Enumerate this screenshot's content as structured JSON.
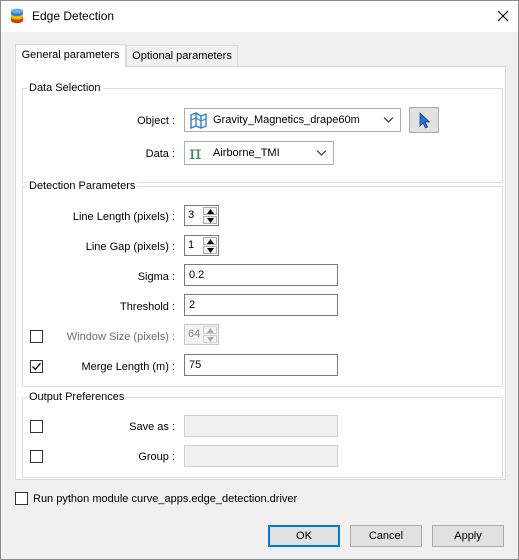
{
  "window": {
    "title": "Edge Detection",
    "close_icon": "close-icon",
    "accent": "#0078d7"
  },
  "tabs": [
    {
      "label": "General parameters",
      "active": true
    },
    {
      "label": "Optional parameters",
      "active": false
    }
  ],
  "data_selection": {
    "title": "Data Selection",
    "object_label": "Object :",
    "object_value": "Gravity_Magnetics_drape60m",
    "object_icon": "surface-mesh-icon",
    "pick_icon": "cursor-arrow-icon",
    "data_label": "Data :",
    "data_value": "Airborne_TMI",
    "data_icon": "pi-icon"
  },
  "detection": {
    "title": "Detection Parameters",
    "line_length_label": "Line Length (pixels) :",
    "line_length_value": "3",
    "line_gap_label": "Line Gap (pixels) :",
    "line_gap_value": "1",
    "sigma_label": "Sigma :",
    "sigma_value": "0.2",
    "threshold_label": "Threshold :",
    "threshold_value": "2",
    "window_size_label": "Window Size (pixels) :",
    "window_size_value": "64",
    "window_size_checked": false,
    "merge_length_label": "Merge Length (m) :",
    "merge_length_value": "75",
    "merge_length_checked": true
  },
  "output": {
    "title": "Output Preferences",
    "save_as_label": "Save as :",
    "save_as_value": "",
    "group_label": "Group :",
    "group_value": ""
  },
  "run_python_label": "Run python module curve_apps.edge_detection.driver",
  "buttons": {
    "ok": "OK",
    "cancel": "Cancel",
    "apply": "Apply"
  }
}
